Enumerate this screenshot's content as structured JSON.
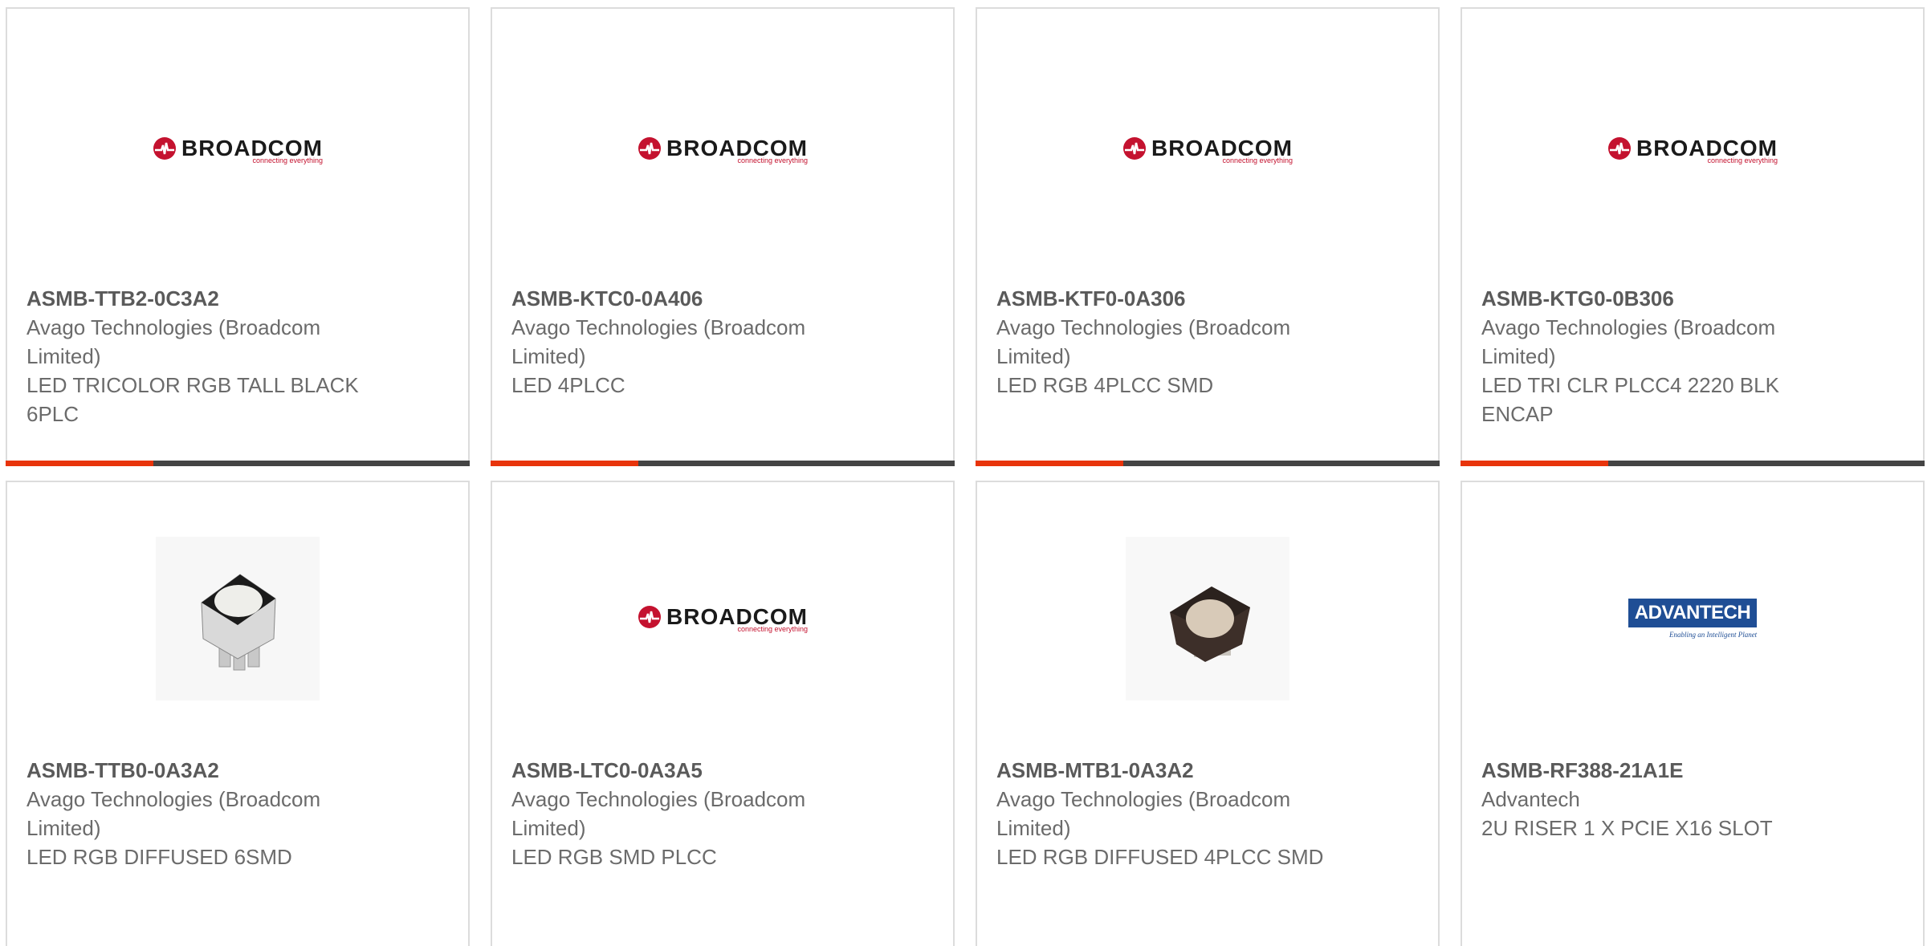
{
  "products": [
    {
      "part": "ASMB-TTB2-0C3A2",
      "manufacturer": "Avago Technologies (Broadcom Limited)",
      "description": "LED TRICOLOR RGB TALL BLACK 6PLC",
      "image": "broadcom-logo"
    },
    {
      "part": "ASMB-KTC0-0A406",
      "manufacturer": "Avago Technologies (Broadcom Limited)",
      "description": "LED 4PLCC",
      "image": "broadcom-logo"
    },
    {
      "part": "ASMB-KTF0-0A306",
      "manufacturer": "Avago Technologies (Broadcom Limited)",
      "description": "LED RGB 4PLCC SMD",
      "image": "broadcom-logo"
    },
    {
      "part": "ASMB-KTG0-0B306",
      "manufacturer": "Avago Technologies (Broadcom Limited)",
      "description": "LED TRI CLR PLCC4 2220 BLK ENCAP",
      "image": "broadcom-logo"
    },
    {
      "part": "ASMB-TTB0-0A3A2",
      "manufacturer": "Avago Technologies (Broadcom Limited)",
      "description": "LED RGB DIFFUSED 6SMD",
      "image": "led-6smd-photo"
    },
    {
      "part": "ASMB-LTC0-0A3A5",
      "manufacturer": "Avago Technologies (Broadcom Limited)",
      "description": "LED RGB SMD PLCC",
      "image": "broadcom-logo"
    },
    {
      "part": "ASMB-MTB1-0A3A2",
      "manufacturer": "Avago Technologies (Broadcom Limited)",
      "description": "LED RGB DIFFUSED 4PLCC SMD",
      "image": "led-4plcc-photo"
    },
    {
      "part": "ASMB-RF388-21A1E",
      "manufacturer": "Advantech",
      "description": "2U RISER 1 X PCIE X16 SLOT",
      "image": "advantech-logo"
    }
  ],
  "logos": {
    "broadcom": {
      "word": "BROADCOM",
      "tagline": "connecting everything"
    },
    "advantech": {
      "word": "ADVANTECH",
      "tagline": "Enabling an Intelligent Planet"
    }
  },
  "colors": {
    "accent": "#e8340b",
    "bar": "#444444",
    "border": "#dcdcdc",
    "text": "#6b6b6b",
    "broadcom_red": "#c4122f",
    "advantech_blue": "#1f4e95"
  }
}
